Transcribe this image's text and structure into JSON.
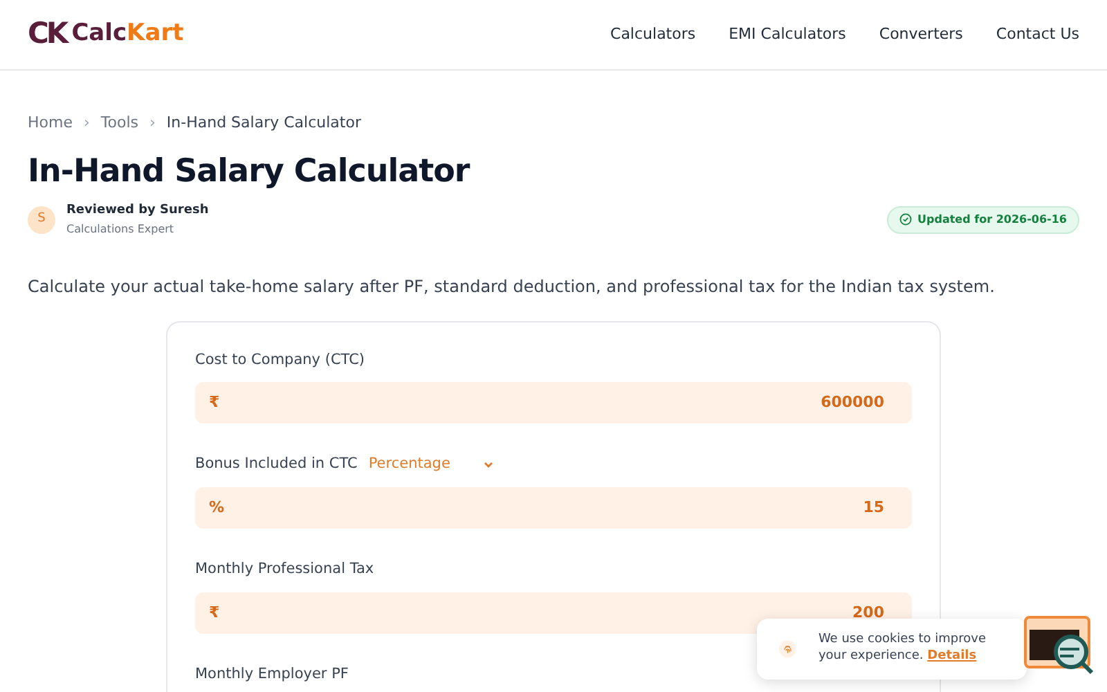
{
  "header": {
    "logo_mark": "CK",
    "brand": [
      {
        "text": "Calc",
        "accent": false
      },
      {
        "text": "Kart",
        "accent": true
      }
    ],
    "nav": [
      "Calculators",
      "EMI Calculators",
      "Converters",
      "Contact Us"
    ]
  },
  "breadcrumb": [
    {
      "label": "Home",
      "current": false
    },
    {
      "label": "Tools",
      "current": false
    },
    {
      "label": "In-Hand Salary Calculator",
      "current": true
    }
  ],
  "breadcrumb_separator": "›",
  "title": "In-Hand Salary Calculator",
  "reviewer": {
    "initial": "S",
    "name": "Reviewed by Suresh",
    "role": "Calculations Expert"
  },
  "updated_badge": "Updated for 2026-06-16",
  "description": "Calculate your actual take-home salary after PF, standard deduction, and professional tax for the Indian tax system.",
  "fields": [
    {
      "label": "Cost to Company (CTC)",
      "prefix": "₹",
      "value": "600000"
    },
    {
      "label": "Bonus Included in CTC",
      "select": "Percentage",
      "prefix": "%",
      "value": "15"
    },
    {
      "label": "Monthly Professional Tax",
      "prefix": "₹",
      "value": "200"
    },
    {
      "label": "Monthly Employer PF"
    }
  ],
  "cookie_banner": {
    "text": "We use cookies to improve your experience.",
    "link": "Details"
  }
}
